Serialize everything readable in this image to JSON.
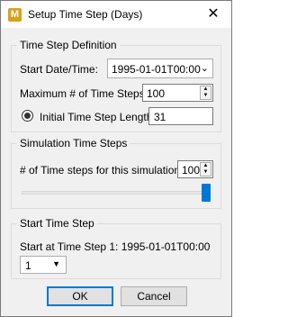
{
  "window": {
    "title": "Setup Time Step (Days)",
    "app_icon_letter": "M",
    "close_glyph": "✕"
  },
  "definition": {
    "group_title": "Time Step Definition",
    "start_label": "Start Date/Time:",
    "start_value": "1995-01-01T00:00",
    "max_label": "Maximum # of Time Steps:",
    "max_value": "100",
    "initial_label": "Initial Time Step Length",
    "initial_value": "31",
    "initial_selected": true
  },
  "simulation": {
    "group_title": "Simulation Time Steps",
    "steps_label": "# of Time steps for this simulation:",
    "steps_value": "100",
    "slider_fraction": 1.0
  },
  "start_step": {
    "group_title": "Start Time Step",
    "info_label": "Start at Time Step 1: 1995-01-01T00:00",
    "select_value": "1"
  },
  "buttons": {
    "ok_label": "OK",
    "cancel_label": "Cancel"
  },
  "icons": {
    "dropdown": "chevron-down-icon",
    "spin_up": "caret-up-icon",
    "spin_down": "caret-down-icon"
  }
}
